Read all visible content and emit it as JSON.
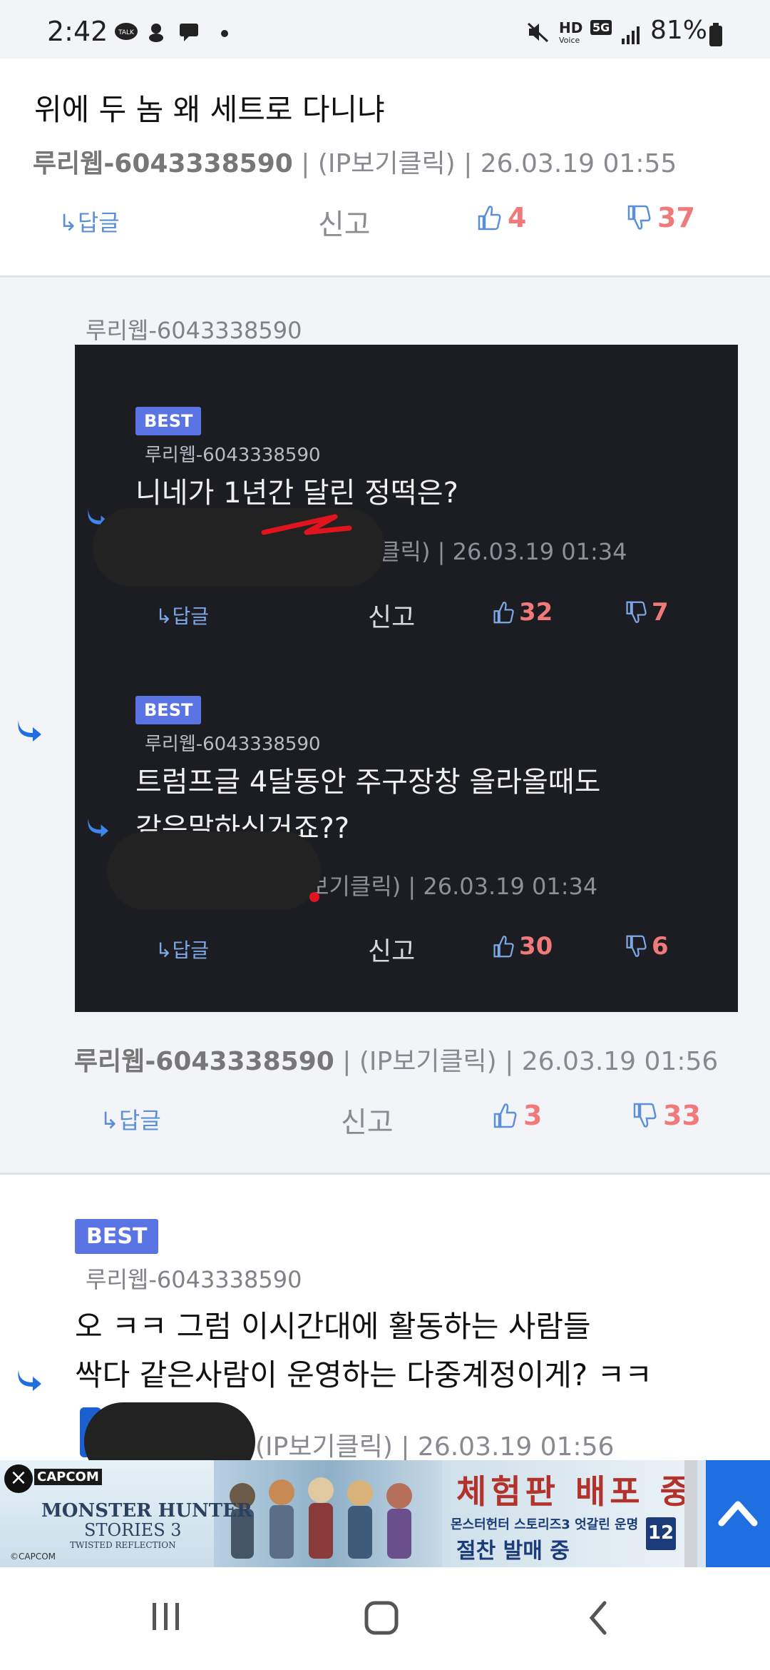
{
  "status_bar": {
    "time": "2:42",
    "battery": "81%",
    "network": "5G",
    "hd_label": "HD",
    "voice_label": "Voice"
  },
  "top_comment": {
    "text": "위에 두 놈 왜 세트로 다니냐",
    "author": "루리웹-6043338590",
    "ip": "(IP보기클릭)",
    "date": "26.03.19 01:55",
    "reply": "답글",
    "report": "신고",
    "up": "4",
    "down": "37"
  },
  "reply_comment": {
    "to": "루리웹-6043338590",
    "quotes": [
      {
        "badge": "BEST",
        "author": "루리웹-6043338590",
        "text": "니네가 1년간 달린 정떡은?",
        "ip": "(IP보기클릭)",
        "date": "26.03.19 01:34",
        "reply": "답글",
        "report": "신고",
        "up": "32",
        "down": "7"
      },
      {
        "badge": "BEST",
        "author": "루리웹-6043338590",
        "text_line1": "트럼프글 4달동안 주구장창 올라올때도",
        "text_line2": "같은말하신거죠??",
        "ip": "보기클릭)",
        "date": "26.03.19 01:34",
        "reply": "답글",
        "report": "신고",
        "up": "30",
        "down": "6"
      }
    ],
    "author": "루리웹-6043338590",
    "ip": "(IP보기클릭)",
    "date": "26.03.19 01:56",
    "reply": "답글",
    "report": "신고",
    "up": "3",
    "down": "33"
  },
  "bottom_comment": {
    "badge": "BEST",
    "to": "루리웹-6043338590",
    "line1": "오 ㅋㅋ 그럼 이시간대에 활동하는 사람들",
    "line2": "싹다 같은사람이 운영하는 다중계정이게? ㅋㅋ",
    "ip": "(IP보기클릭)",
    "date": "26.03.19 01:56"
  },
  "ad": {
    "brand": "CAPCOM",
    "game_title": "MONSTER HUNTER",
    "game_sub": "STORIES 3",
    "game_sub2": "TWISTED REFLECTION",
    "headline": "체험판 배포 중",
    "subline": "몬스터헌터 스토리즈3 엇갈린 운명",
    "sale": "절찬 발매 중",
    "copyright": "©CAPCOM",
    "rating": "12"
  },
  "colors": {
    "accent": "#5b74e3",
    "vote": "#f07a7a",
    "link": "#5b8fd6",
    "scroll_top": "#1f6fe0"
  }
}
